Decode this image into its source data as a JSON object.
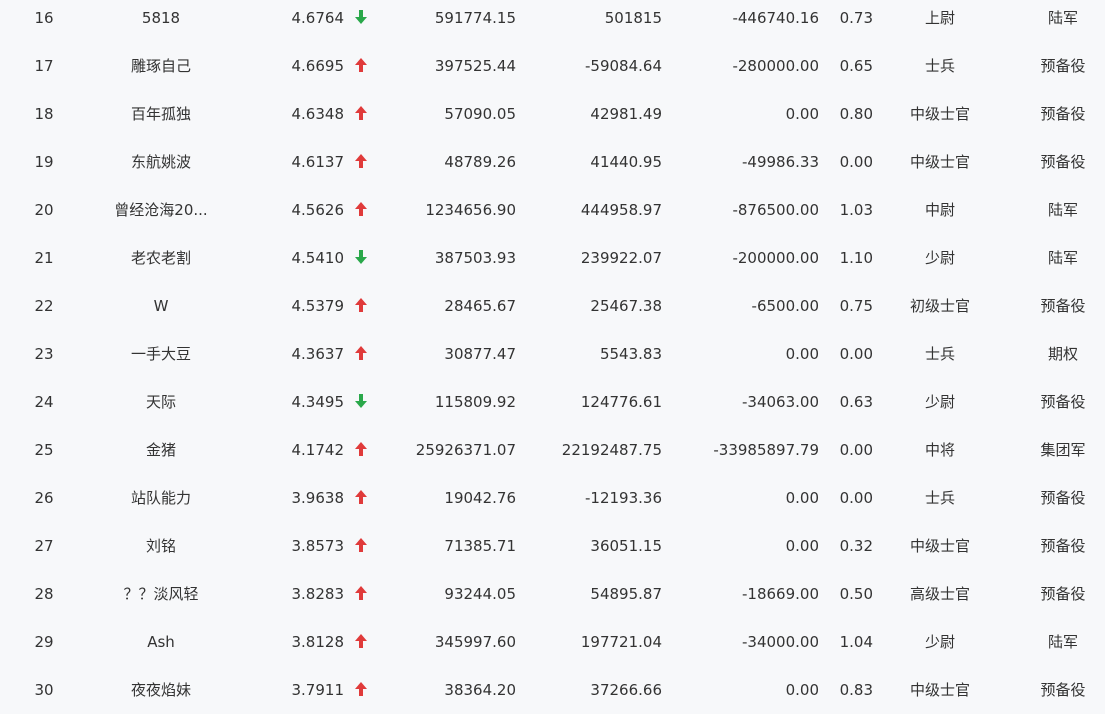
{
  "colors": {
    "up": "#e03a3a",
    "down": "#2aa84a",
    "text": "#333333",
    "background": "#f7f8fa"
  },
  "rows": [
    {
      "rank": "16",
      "name": "5818",
      "score": "4.6764",
      "trend": "down",
      "trend_icon": "arrow-down-icon",
      "col_a": "591774.15",
      "col_b": "501815",
      "col_c": "-446740.16",
      "ratio": "0.73",
      "title": "上尉",
      "type": "陆军"
    },
    {
      "rank": "17",
      "name": "雕琢自己",
      "score": "4.6695",
      "trend": "up",
      "trend_icon": "arrow-up-icon",
      "col_a": "397525.44",
      "col_b": "-59084.64",
      "col_c": "-280000.00",
      "ratio": "0.65",
      "title": "士兵",
      "type": "预备役"
    },
    {
      "rank": "18",
      "name": "百年孤独",
      "score": "4.6348",
      "trend": "up",
      "trend_icon": "arrow-up-icon",
      "col_a": "57090.05",
      "col_b": "42981.49",
      "col_c": "0.00",
      "ratio": "0.80",
      "title": "中级士官",
      "type": "预备役"
    },
    {
      "rank": "19",
      "name": "东航姚波",
      "score": "4.6137",
      "trend": "up",
      "trend_icon": "arrow-up-icon",
      "col_a": "48789.26",
      "col_b": "41440.95",
      "col_c": "-49986.33",
      "ratio": "0.00",
      "title": "中级士官",
      "type": "预备役"
    },
    {
      "rank": "20",
      "name": "曾经沧海20...",
      "score": "4.5626",
      "trend": "up",
      "trend_icon": "arrow-up-icon",
      "col_a": "1234656.90",
      "col_b": "444958.97",
      "col_c": "-876500.00",
      "ratio": "1.03",
      "title": "中尉",
      "type": "陆军"
    },
    {
      "rank": "21",
      "name": "老农老割",
      "score": "4.5410",
      "trend": "down",
      "trend_icon": "arrow-down-icon",
      "col_a": "387503.93",
      "col_b": "239922.07",
      "col_c": "-200000.00",
      "ratio": "1.10",
      "title": "少尉",
      "type": "陆军"
    },
    {
      "rank": "22",
      "name": "W",
      "score": "4.5379",
      "trend": "up",
      "trend_icon": "arrow-up-icon",
      "col_a": "28465.67",
      "col_b": "25467.38",
      "col_c": "-6500.00",
      "ratio": "0.75",
      "title": "初级士官",
      "type": "预备役"
    },
    {
      "rank": "23",
      "name": "一手大豆",
      "score": "4.3637",
      "trend": "up",
      "trend_icon": "arrow-up-icon",
      "col_a": "30877.47",
      "col_b": "5543.83",
      "col_c": "0.00",
      "ratio": "0.00",
      "title": "士兵",
      "type": "期权"
    },
    {
      "rank": "24",
      "name": "天际",
      "score": "4.3495",
      "trend": "down",
      "trend_icon": "arrow-down-icon",
      "col_a": "115809.92",
      "col_b": "124776.61",
      "col_c": "-34063.00",
      "ratio": "0.63",
      "title": "少尉",
      "type": "预备役"
    },
    {
      "rank": "25",
      "name": "金猪",
      "score": "4.1742",
      "trend": "up",
      "trend_icon": "arrow-up-icon",
      "col_a": "25926371.07",
      "col_b": "22192487.75",
      "col_c": "-33985897.79",
      "ratio": "0.00",
      "title": "中将",
      "type": "集团军"
    },
    {
      "rank": "26",
      "name": "站队能力",
      "score": "3.9638",
      "trend": "up",
      "trend_icon": "arrow-up-icon",
      "col_a": "19042.76",
      "col_b": "-12193.36",
      "col_c": "0.00",
      "ratio": "0.00",
      "title": "士兵",
      "type": "预备役"
    },
    {
      "rank": "27",
      "name": "刘铭",
      "score": "3.8573",
      "trend": "up",
      "trend_icon": "arrow-up-icon",
      "col_a": "71385.71",
      "col_b": "36051.15",
      "col_c": "0.00",
      "ratio": "0.32",
      "title": "中级士官",
      "type": "预备役"
    },
    {
      "rank": "28",
      "name": "？？淡风轻",
      "score": "3.8283",
      "trend": "up",
      "trend_icon": "arrow-up-icon",
      "col_a": "93244.05",
      "col_b": "54895.87",
      "col_c": "-18669.00",
      "ratio": "0.50",
      "title": "高级士官",
      "type": "预备役"
    },
    {
      "rank": "29",
      "name": "Ash",
      "score": "3.8128",
      "trend": "up",
      "trend_icon": "arrow-up-icon",
      "col_a": "345997.60",
      "col_b": "197721.04",
      "col_c": "-34000.00",
      "ratio": "1.04",
      "title": "少尉",
      "type": "陆军"
    },
    {
      "rank": "30",
      "name": "夜夜焰妹",
      "score": "3.7911",
      "trend": "up",
      "trend_icon": "arrow-up-icon",
      "col_a": "38364.20",
      "col_b": "37266.66",
      "col_c": "0.00",
      "ratio": "0.83",
      "title": "中级士官",
      "type": "预备役"
    }
  ]
}
